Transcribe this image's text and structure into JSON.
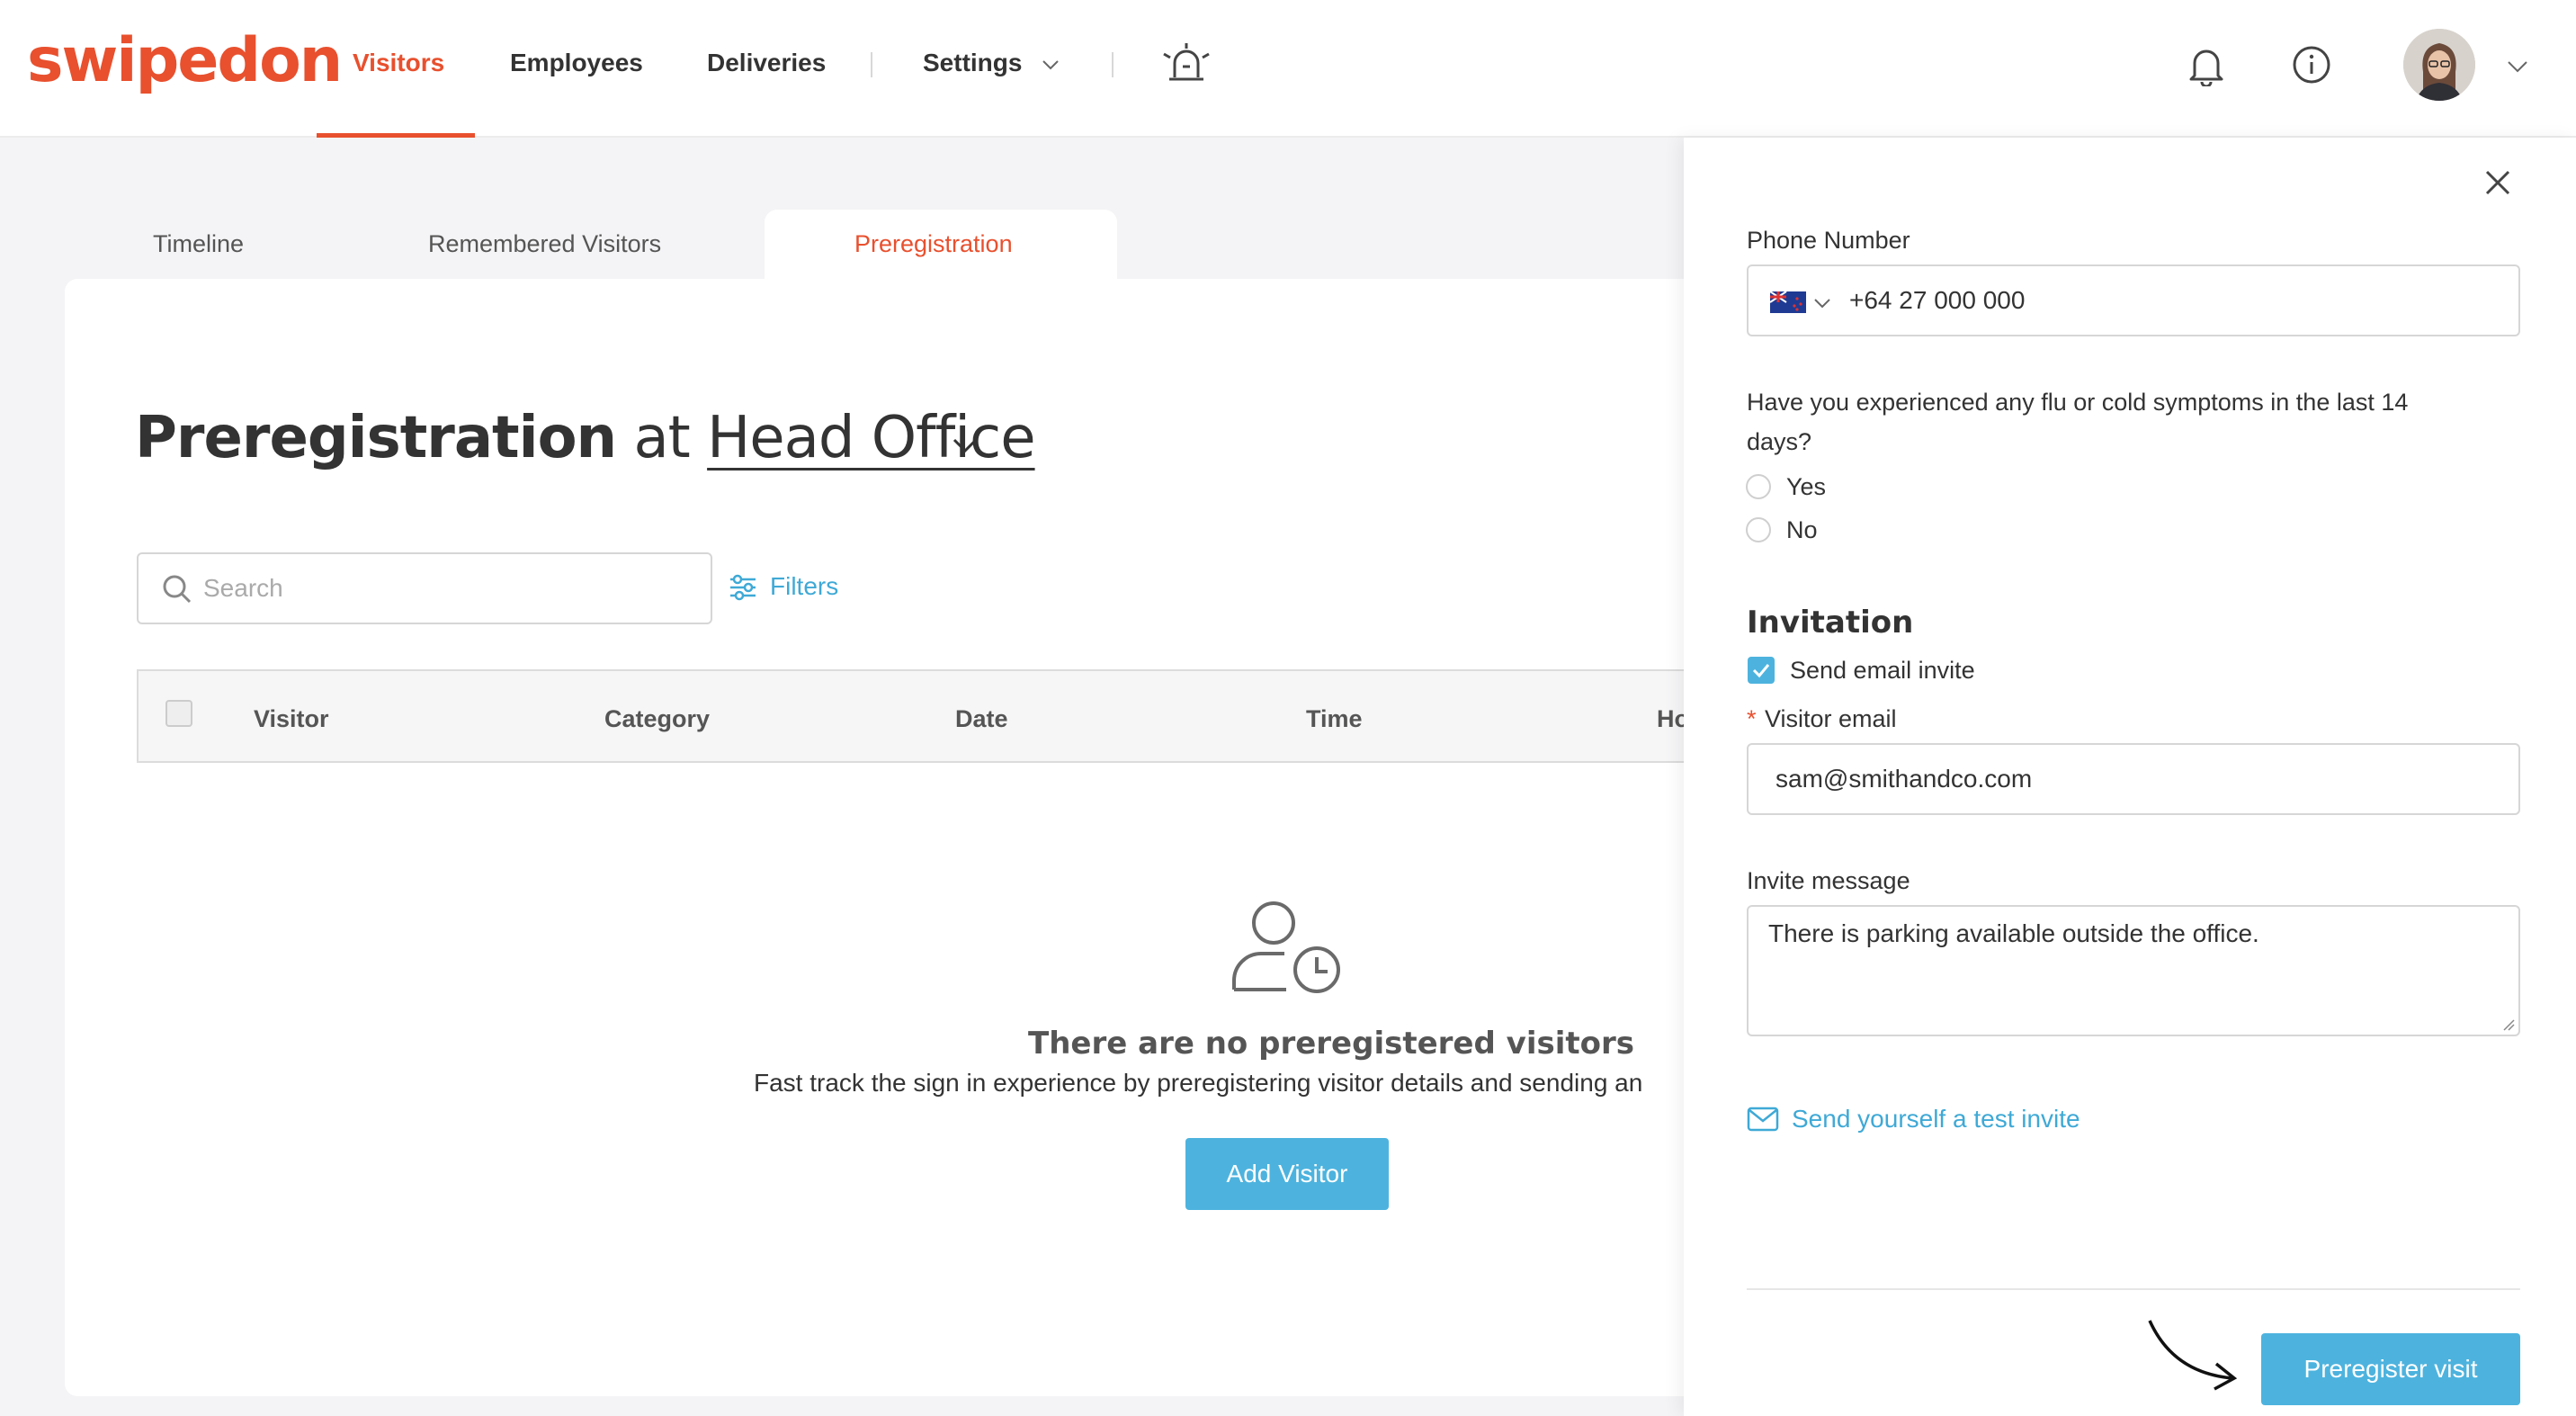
{
  "brand": {
    "logo": "swipedon",
    "accent": "#e8502e",
    "link_color": "#3fa9d6",
    "button_color": "#4db3de"
  },
  "nav": {
    "items": [
      {
        "label": "Visitors",
        "active": true
      },
      {
        "label": "Employees"
      },
      {
        "label": "Deliveries"
      },
      {
        "label": "Settings"
      }
    ],
    "icons": [
      "alarm-light-icon",
      "bell-icon",
      "info-icon",
      "avatar",
      "chevron-down-icon"
    ]
  },
  "tabs": [
    {
      "label": "Timeline"
    },
    {
      "label": "Remembered Visitors"
    },
    {
      "label": "Preregistration",
      "active": true
    }
  ],
  "page": {
    "title": "Preregistration",
    "at": "at",
    "location": "Head Office"
  },
  "search": {
    "placeholder": "Search"
  },
  "filters_label": "Filters",
  "table": {
    "columns": [
      "Visitor",
      "Category",
      "Date",
      "Time",
      "Ho"
    ]
  },
  "empty_state": {
    "title": "There are no preregistered visitors",
    "description": "Fast track the sign in experience by preregistering visitor details and sending an",
    "button": "Add Visitor"
  },
  "panel": {
    "phone_label": "Phone Number",
    "phone_value": "+64 27 000 000",
    "question": "Have you experienced any flu or cold symptoms in the last 14",
    "question_cont": "days?",
    "options": [
      "Yes",
      "No"
    ],
    "invitation_title": "Invitation",
    "send_email_label": "Send email invite",
    "required_mark": "*",
    "visitor_email_label": "Visitor email",
    "visitor_email_value": "sam@smithandco.com",
    "invite_message_label": "Invite message",
    "invite_message_value": "There is parking available outside the office.",
    "test_invite_link": "Send yourself a test invite",
    "submit": "Preregister visit"
  }
}
